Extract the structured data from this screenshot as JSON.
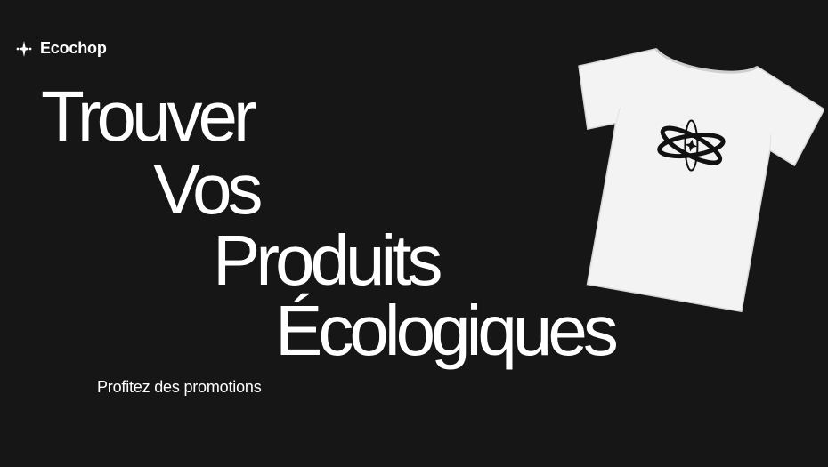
{
  "brand": {
    "name": "Ecochop",
    "icon": "sparkle-logo-icon"
  },
  "hero": {
    "headline": [
      "Trouver",
      "Vos",
      "Produits",
      "Écologiques"
    ],
    "promo_link": "Profitez des promotions"
  },
  "product_image": {
    "icon": "tshirt-image",
    "print_icon": "atom-orbit-icon"
  },
  "colors": {
    "background": "#161616",
    "text": "#ffffff",
    "shirt": "#f3f3f3",
    "print": "#111111"
  }
}
